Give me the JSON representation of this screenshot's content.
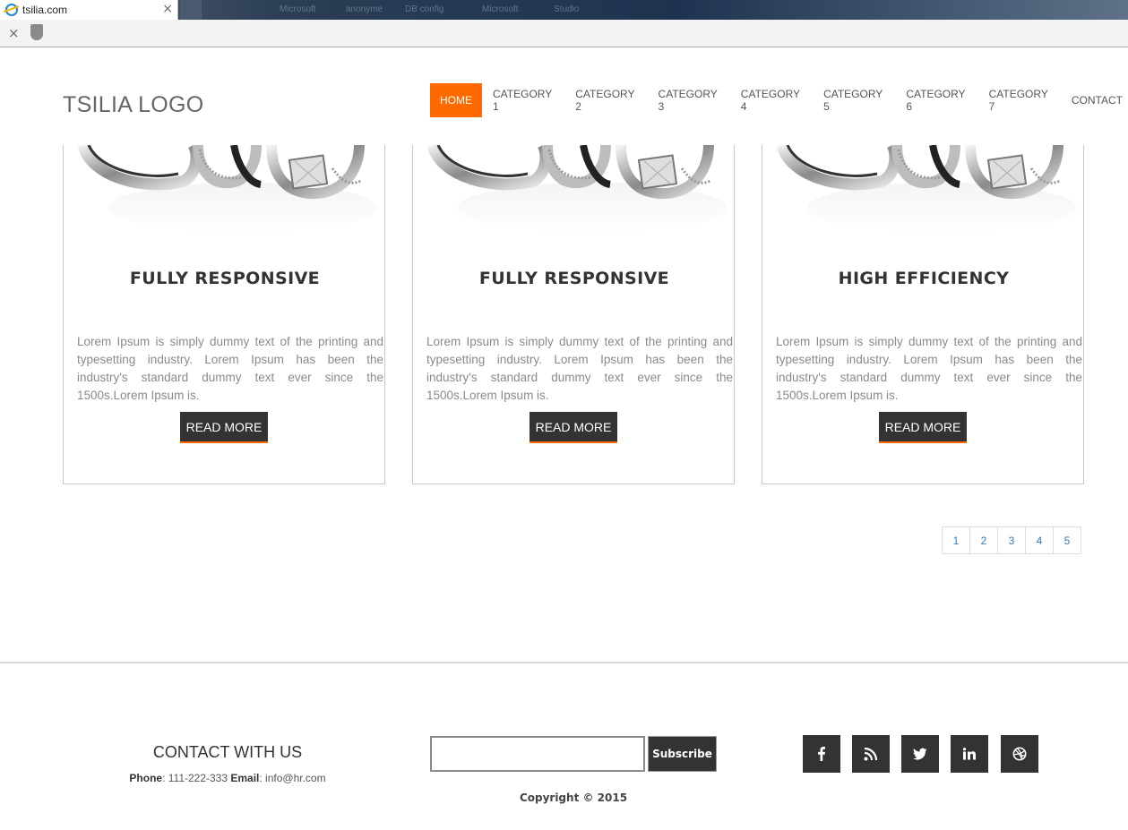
{
  "browser": {
    "tab_title": "tsilia.com",
    "tab_close": "×",
    "blurred_tabs": [
      "Microsoft",
      "anonyme",
      "DB config",
      "Microsoft",
      "Studio"
    ],
    "toolbar_close": "×"
  },
  "header": {
    "logo": "TSILIA LOGO",
    "nav": [
      {
        "label": "HOME",
        "active": true
      },
      {
        "label": "CATEGORY 1"
      },
      {
        "label": "CATEGORY 2"
      },
      {
        "label": "CATEGORY 3"
      },
      {
        "label": "CATEGORY 4"
      },
      {
        "label": "CATEGORY 5"
      },
      {
        "label": "CATEGORY 6"
      },
      {
        "label": "CATEGORY 7"
      },
      {
        "label": "CONTACT"
      }
    ]
  },
  "cards": [
    {
      "title": "FULLY RESPONSIVE",
      "text": "Lorem Ipsum is simply dummy text of the printing and typesetting industry. Lorem Ipsum has been the industry's standard dummy text ever since the 1500s.Lorem Ipsum is.",
      "button": "READ MORE"
    },
    {
      "title": "FULLY RESPONSIVE",
      "text": "Lorem Ipsum is simply dummy text of the printing and typesetting industry. Lorem Ipsum has been the industry's standard dummy text ever since the 1500s.Lorem Ipsum is.",
      "button": "READ MORE"
    },
    {
      "title": "HIGH EFFICIENCY",
      "text": "Lorem Ipsum is simply dummy text of the printing and typesetting industry. Lorem Ipsum has been the industry's standard dummy text ever since the 1500s.Lorem Ipsum is.",
      "button": "READ MORE"
    }
  ],
  "pagination": [
    "1",
    "2",
    "3",
    "4",
    "5"
  ],
  "footer": {
    "contact_title": "CONTACT WITH US",
    "phone_label": "Phone",
    "phone_value": ": 111-222-333 ",
    "email_label": "Email",
    "email_value": ": info@hr.com",
    "subscribe_input_value": "",
    "subscribe_label": "Subscribe",
    "copyright": "Copyright © 2015",
    "social": [
      "facebook-icon",
      "rss-icon",
      "twitter-icon",
      "linkedin-icon",
      "dribbble-icon"
    ]
  },
  "colors": {
    "accent": "#ff6a00",
    "dark_button": "#333333",
    "link": "#337ab7"
  }
}
